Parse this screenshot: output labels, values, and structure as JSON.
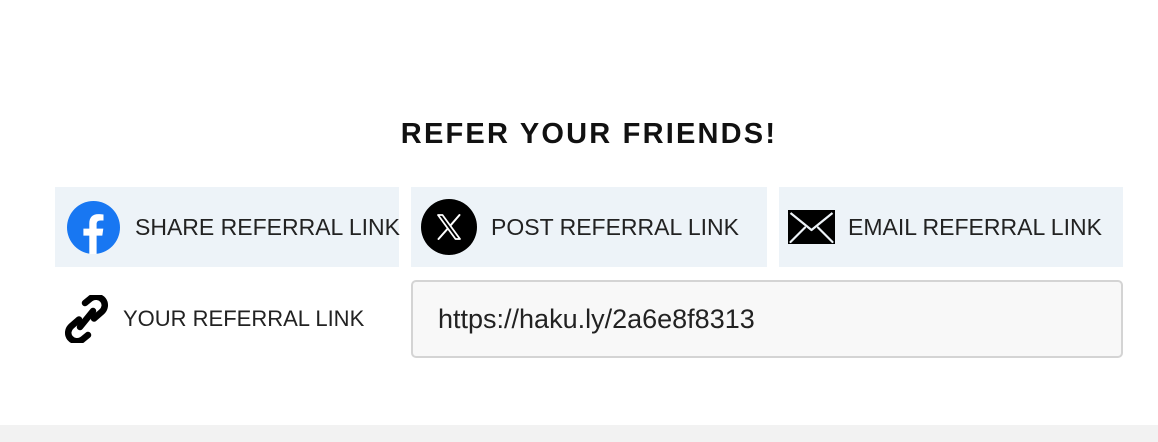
{
  "referral": {
    "title": "REFER YOUR FRIENDS!",
    "buttons": [
      {
        "id": "facebook",
        "label": "SHARE REFERRAL LINK",
        "icon": "facebook-icon",
        "icon_color": "#1877f2"
      },
      {
        "id": "x",
        "label": "POST REFERRAL LINK",
        "icon": "x-logo-icon",
        "icon_color": "#000000"
      },
      {
        "id": "email",
        "label": "EMAIL REFERRAL LINK",
        "icon": "envelope-icon",
        "icon_color": "#000000"
      }
    ],
    "link_label": "YOUR REFERRAL LINK",
    "link_icon": "chain-link-icon",
    "link_value": "https://haku.ly/2a6e8f8313"
  },
  "colors": {
    "button_background": "#edf3f8",
    "facebook_blue": "#1877f2",
    "text": "#222222"
  }
}
